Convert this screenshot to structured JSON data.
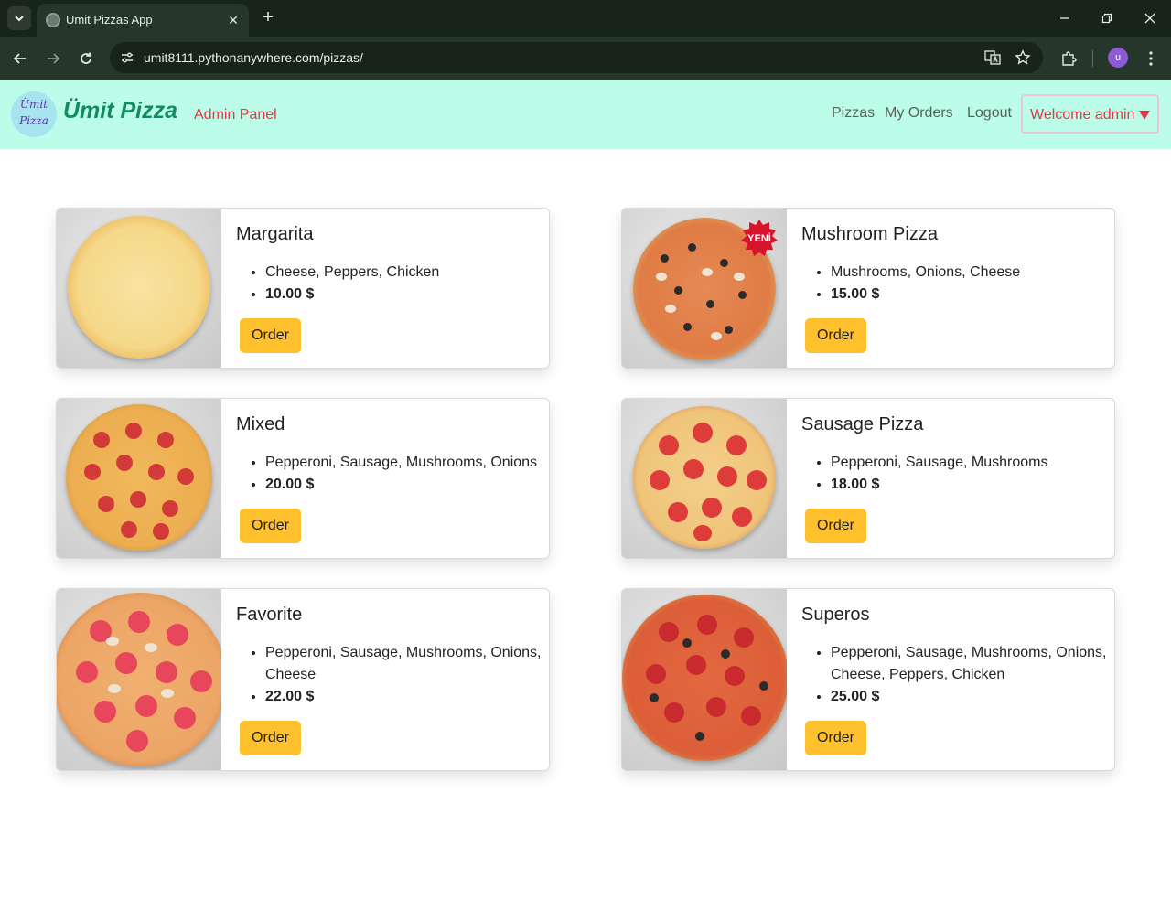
{
  "browser": {
    "tab_title": "Umit Pizzas App",
    "url": "umit8111.pythonanywhere.com/pizzas/",
    "profile_initial": "u"
  },
  "site": {
    "logo_line1": "Ümit",
    "logo_line2": "Pizza",
    "brand": "Ümit Pizza",
    "admin_link": "Admin Panel",
    "nav": {
      "pizzas": "Pizzas",
      "my_orders": "My Orders",
      "logout": "Logout",
      "welcome": "Welcome admin"
    },
    "colors": {
      "navbar_bg": "#bcfde9",
      "brand": "#138a62",
      "accent": "#e23849",
      "order_button": "#ffc02d"
    }
  },
  "pizzas": [
    {
      "name": "Margarita",
      "ingredients": "Cheese, Peppers, Chicken",
      "price": "10.00 $",
      "order_label": "Order",
      "badge": ""
    },
    {
      "name": "Mushroom Pizza",
      "ingredients": "Mushrooms, Onions, Cheese",
      "price": "15.00 $",
      "order_label": "Order",
      "badge": "YENİ"
    },
    {
      "name": "Mixed",
      "ingredients": "Pepperoni, Sausage, Mushrooms, Onions",
      "price": "20.00 $",
      "order_label": "Order",
      "badge": ""
    },
    {
      "name": "Sausage Pizza",
      "ingredients": "Pepperoni, Sausage, Mushrooms",
      "price": "18.00 $",
      "order_label": "Order",
      "badge": ""
    },
    {
      "name": "Favorite",
      "ingredients": "Pepperoni, Sausage, Mushrooms, Onions, Cheese",
      "price": "22.00 $",
      "order_label": "Order",
      "badge": ""
    },
    {
      "name": "Superos",
      "ingredients": "Pepperoni, Sausage, Mushrooms, Onions, Cheese, Peppers, Chicken",
      "price": "25.00 $",
      "order_label": "Order",
      "badge": ""
    }
  ]
}
